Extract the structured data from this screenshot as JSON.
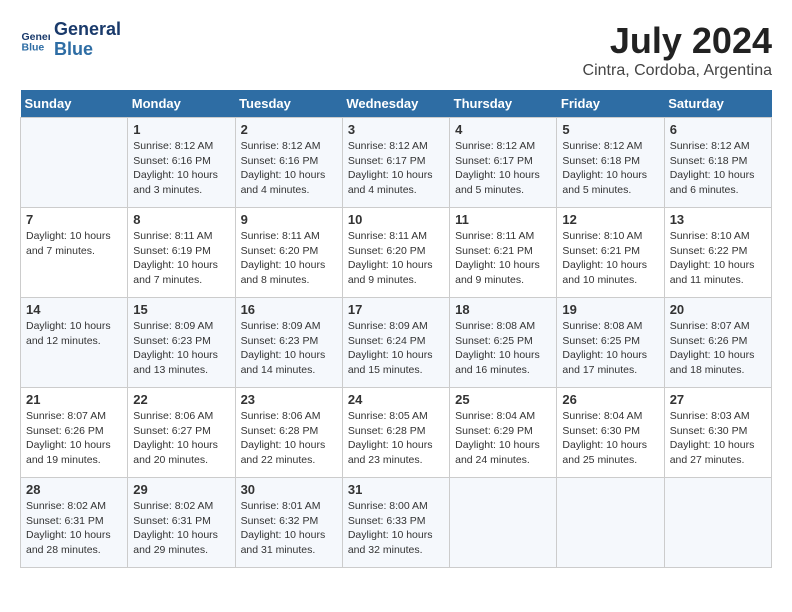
{
  "header": {
    "logo_line1": "General",
    "logo_line2": "Blue",
    "title": "July 2024",
    "subtitle": "Cintra, Cordoba, Argentina"
  },
  "calendar": {
    "days_of_week": [
      "Sunday",
      "Monday",
      "Tuesday",
      "Wednesday",
      "Thursday",
      "Friday",
      "Saturday"
    ],
    "weeks": [
      [
        {
          "day": "",
          "info": ""
        },
        {
          "day": "1",
          "info": "Sunrise: 8:12 AM\nSunset: 6:16 PM\nDaylight: 10 hours\nand 3 minutes."
        },
        {
          "day": "2",
          "info": "Sunrise: 8:12 AM\nSunset: 6:16 PM\nDaylight: 10 hours\nand 4 minutes."
        },
        {
          "day": "3",
          "info": "Sunrise: 8:12 AM\nSunset: 6:17 PM\nDaylight: 10 hours\nand 4 minutes."
        },
        {
          "day": "4",
          "info": "Sunrise: 8:12 AM\nSunset: 6:17 PM\nDaylight: 10 hours\nand 5 minutes."
        },
        {
          "day": "5",
          "info": "Sunrise: 8:12 AM\nSunset: 6:18 PM\nDaylight: 10 hours\nand 5 minutes."
        },
        {
          "day": "6",
          "info": "Sunrise: 8:12 AM\nSunset: 6:18 PM\nDaylight: 10 hours\nand 6 minutes."
        }
      ],
      [
        {
          "day": "7",
          "info": "Daylight: 10 hours\nand 7 minutes."
        },
        {
          "day": "8",
          "info": "Sunrise: 8:11 AM\nSunset: 6:19 PM\nDaylight: 10 hours\nand 7 minutes."
        },
        {
          "day": "9",
          "info": "Sunrise: 8:11 AM\nSunset: 6:20 PM\nDaylight: 10 hours\nand 8 minutes."
        },
        {
          "day": "10",
          "info": "Sunrise: 8:11 AM\nSunset: 6:20 PM\nDaylight: 10 hours\nand 9 minutes."
        },
        {
          "day": "11",
          "info": "Sunrise: 8:11 AM\nSunset: 6:21 PM\nDaylight: 10 hours\nand 9 minutes."
        },
        {
          "day": "12",
          "info": "Sunrise: 8:10 AM\nSunset: 6:21 PM\nDaylight: 10 hours\nand 10 minutes."
        },
        {
          "day": "13",
          "info": "Sunrise: 8:10 AM\nSunset: 6:22 PM\nDaylight: 10 hours\nand 11 minutes."
        }
      ],
      [
        {
          "day": "14",
          "info": "Daylight: 10 hours\nand 12 minutes."
        },
        {
          "day": "15",
          "info": "Sunrise: 8:09 AM\nSunset: 6:23 PM\nDaylight: 10 hours\nand 13 minutes."
        },
        {
          "day": "16",
          "info": "Sunrise: 8:09 AM\nSunset: 6:23 PM\nDaylight: 10 hours\nand 14 minutes."
        },
        {
          "day": "17",
          "info": "Sunrise: 8:09 AM\nSunset: 6:24 PM\nDaylight: 10 hours\nand 15 minutes."
        },
        {
          "day": "18",
          "info": "Sunrise: 8:08 AM\nSunset: 6:25 PM\nDaylight: 10 hours\nand 16 minutes."
        },
        {
          "day": "19",
          "info": "Sunrise: 8:08 AM\nSunset: 6:25 PM\nDaylight: 10 hours\nand 17 minutes."
        },
        {
          "day": "20",
          "info": "Sunrise: 8:07 AM\nSunset: 6:26 PM\nDaylight: 10 hours\nand 18 minutes."
        }
      ],
      [
        {
          "day": "21",
          "info": "Sunrise: 8:07 AM\nSunset: 6:26 PM\nDaylight: 10 hours\nand 19 minutes."
        },
        {
          "day": "22",
          "info": "Sunrise: 8:06 AM\nSunset: 6:27 PM\nDaylight: 10 hours\nand 20 minutes."
        },
        {
          "day": "23",
          "info": "Sunrise: 8:06 AM\nSunset: 6:28 PM\nDaylight: 10 hours\nand 22 minutes."
        },
        {
          "day": "24",
          "info": "Sunrise: 8:05 AM\nSunset: 6:28 PM\nDaylight: 10 hours\nand 23 minutes."
        },
        {
          "day": "25",
          "info": "Sunrise: 8:04 AM\nSunset: 6:29 PM\nDaylight: 10 hours\nand 24 minutes."
        },
        {
          "day": "26",
          "info": "Sunrise: 8:04 AM\nSunset: 6:30 PM\nDaylight: 10 hours\nand 25 minutes."
        },
        {
          "day": "27",
          "info": "Sunrise: 8:03 AM\nSunset: 6:30 PM\nDaylight: 10 hours\nand 27 minutes."
        }
      ],
      [
        {
          "day": "28",
          "info": "Sunrise: 8:02 AM\nSunset: 6:31 PM\nDaylight: 10 hours\nand 28 minutes."
        },
        {
          "day": "29",
          "info": "Sunrise: 8:02 AM\nSunset: 6:31 PM\nDaylight: 10 hours\nand 29 minutes."
        },
        {
          "day": "30",
          "info": "Sunrise: 8:01 AM\nSunset: 6:32 PM\nDaylight: 10 hours\nand 31 minutes."
        },
        {
          "day": "31",
          "info": "Sunrise: 8:00 AM\nSunset: 6:33 PM\nDaylight: 10 hours\nand 32 minutes."
        },
        {
          "day": "",
          "info": ""
        },
        {
          "day": "",
          "info": ""
        },
        {
          "day": "",
          "info": ""
        }
      ]
    ]
  }
}
